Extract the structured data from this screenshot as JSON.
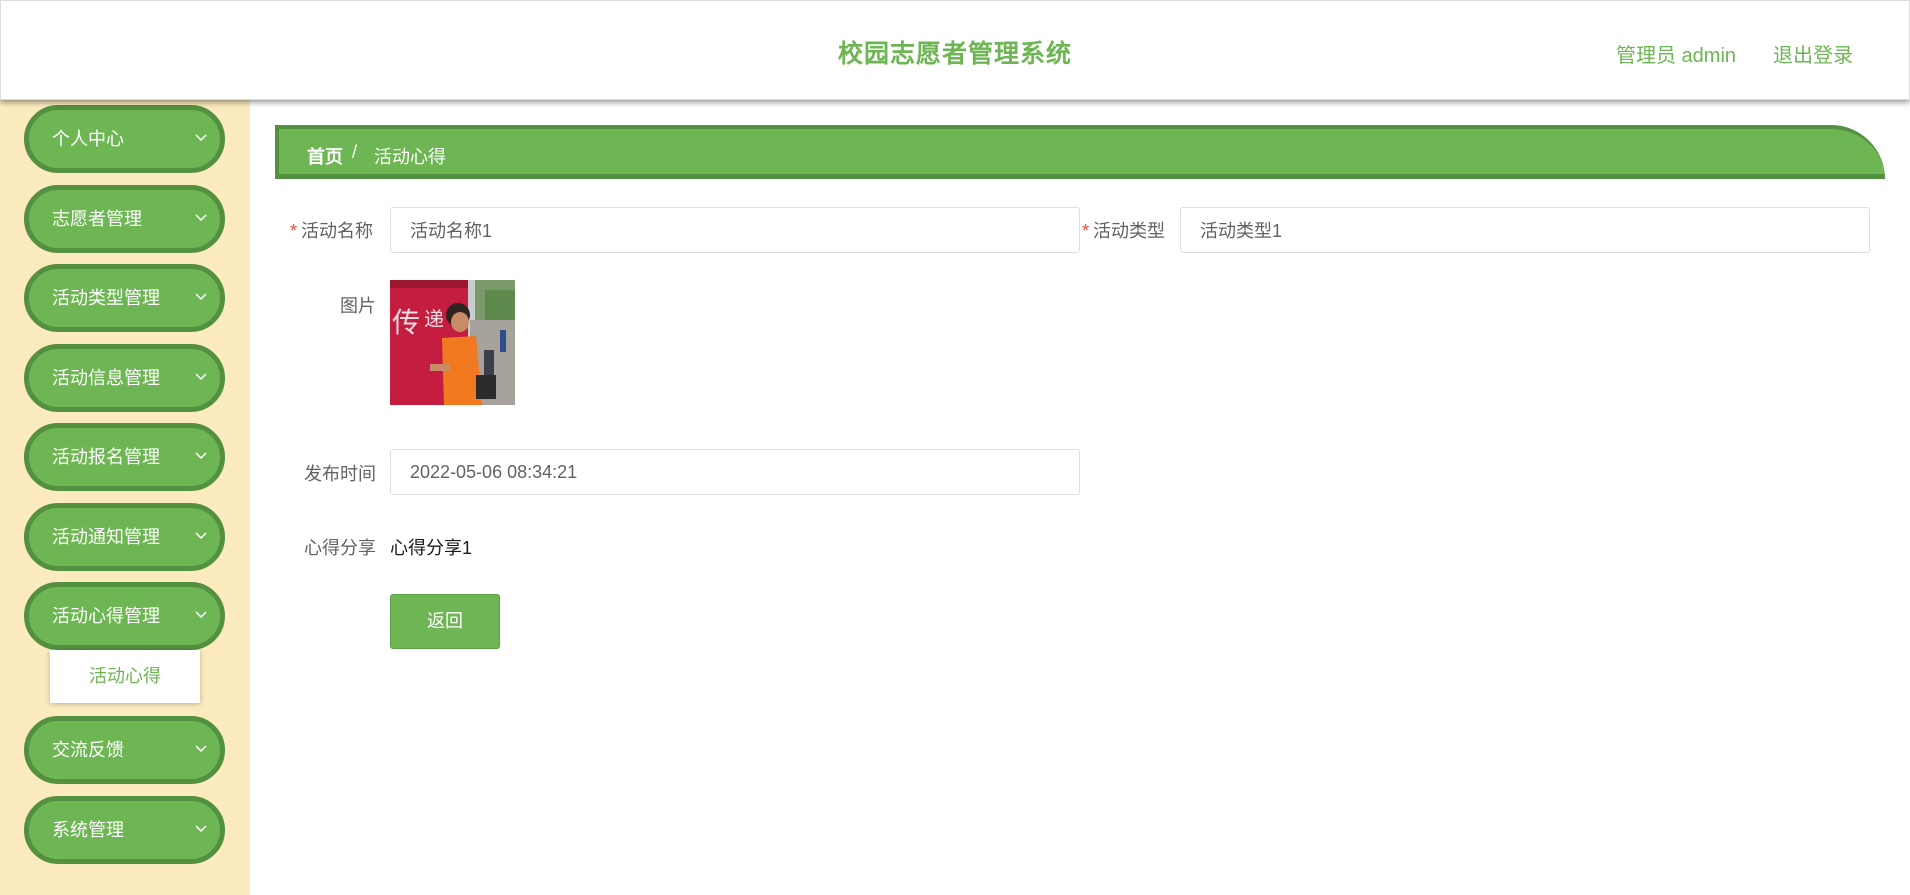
{
  "header": {
    "title": "校园志愿者管理系统",
    "user": "管理员 admin",
    "logout": "退出登录"
  },
  "sidebar": {
    "items": [
      {
        "label": "个人中心"
      },
      {
        "label": "志愿者管理"
      },
      {
        "label": "活动类型管理"
      },
      {
        "label": "活动信息管理"
      },
      {
        "label": "活动报名管理"
      },
      {
        "label": "活动通知管理"
      },
      {
        "label": "活动心得管理"
      },
      {
        "label": "交流反馈"
      },
      {
        "label": "系统管理"
      }
    ],
    "submenu": {
      "label": "活动心得"
    },
    "chevron_icon": "chevron-down-icon"
  },
  "breadcrumb": {
    "home": "首页",
    "separator": "/",
    "current": "活动心得"
  },
  "form": {
    "activity_name": {
      "label": "活动名称",
      "value": "活动名称1"
    },
    "activity_type": {
      "label": "活动类型",
      "value": "活动类型1"
    },
    "picture": {
      "label": "图片"
    },
    "publish_time": {
      "label": "发布时间",
      "value": "2022-05-06 08:34:21"
    },
    "sharing": {
      "label": "心得分享",
      "value": "心得分享1"
    },
    "required_mark": "*"
  },
  "actions": {
    "back": "返回"
  },
  "colors": {
    "accent": "#6db653",
    "accent_dark": "#53903f",
    "sidebar_bg": "#fcebbf",
    "required": "#e74c3c"
  }
}
